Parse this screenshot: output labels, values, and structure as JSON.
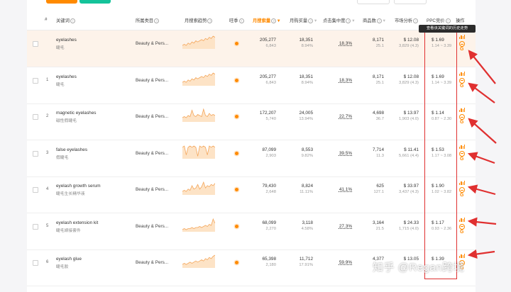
{
  "colors": {
    "accent": "#ff8a00",
    "highlight_row": "#fdf3ea",
    "annotation": "#e03030"
  },
  "header": {
    "idx": "#",
    "keyword": "关键词",
    "category": "所属类目",
    "trend": "月搜索趋势",
    "season": "旺季",
    "search_vol": "月搜索量",
    "purchase_vol": "月购买量",
    "click_conc": "点击集中度",
    "products": "商品数",
    "market": "市场分析",
    "ppc": "PPC竞价",
    "ops": "操作"
  },
  "tooltip": "查看该关键词的历史走势",
  "rows": [
    {
      "idx": "",
      "keyword": "eyelashes",
      "keyword_cn": "睫毛",
      "category": "Beauty & Pers...",
      "search": "205,277",
      "search_sub": "6,843",
      "purchase": "18,351",
      "purchase_pct": "8.94%",
      "click": "18.3%",
      "products": "8,171",
      "products_sub": "25.1",
      "market_price": "$ 12.08",
      "market_sub": "3,829 (4.3)",
      "ppc": "$ 1.69",
      "ppc_range": "1.14 ~ 3.39",
      "trend": [
        3,
        4,
        3,
        5,
        4,
        6,
        5,
        7,
        6,
        7,
        8,
        7,
        9,
        8,
        10,
        9,
        11,
        10
      ]
    },
    {
      "idx": "1",
      "keyword": "eyelashes",
      "keyword_cn": "睫毛",
      "category": "Beauty & Pers...",
      "search": "205,277",
      "search_sub": "6,843",
      "purchase": "18,351",
      "purchase_pct": "8.94%",
      "click": "18.3%",
      "products": "8,171",
      "products_sub": "25.1",
      "market_price": "$ 12.08",
      "market_sub": "3,829 (4.3)",
      "ppc": "$ 1.69",
      "ppc_range": "1.14 ~ 3.39",
      "trend": [
        3,
        4,
        3,
        5,
        4,
        6,
        5,
        7,
        6,
        7,
        8,
        7,
        9,
        8,
        10,
        9,
        11,
        10
      ]
    },
    {
      "idx": "2",
      "keyword": "magnetic eyelashes",
      "keyword_cn": "磁性假睫毛",
      "category": "Beauty & Pers...",
      "search": "172,207",
      "search_sub": "5,740",
      "purchase": "24,005",
      "purchase_pct": "13.94%",
      "click": "22.7%",
      "products": "4,698",
      "products_sub": "36.7",
      "market_price": "$ 13.97",
      "market_sub": "1,903 (4.0)",
      "ppc": "$ 1.14",
      "ppc_range": "0.87 ~ 2.30",
      "trend": [
        4,
        5,
        4,
        6,
        5,
        11,
        6,
        5,
        7,
        6,
        5,
        12,
        6,
        5,
        8,
        6,
        7,
        6
      ]
    },
    {
      "idx": "3",
      "keyword": "false eyelashes",
      "keyword_cn": "假睫毛",
      "category": "Beauty & Pers...",
      "search": "87,099",
      "search_sub": "2,903",
      "purchase": "8,553",
      "purchase_pct": "9.82%",
      "click": "39.5%",
      "products": "7,714",
      "products_sub": "11.3",
      "market_price": "$ 11.41",
      "market_sub": "5,661 (4.4)",
      "ppc": "$ 1.53",
      "ppc_range": "1.17 ~ 3.08",
      "trend": [
        9,
        10,
        3,
        9,
        10,
        9,
        10,
        9,
        2,
        10,
        9,
        10,
        9,
        3,
        10,
        9,
        10,
        9
      ]
    },
    {
      "idx": "4",
      "keyword": "eyelash growth serum",
      "keyword_cn": "睫毛生长精华液",
      "category": "Beauty & Pers...",
      "search": "79,430",
      "search_sub": "2,648",
      "purchase": "8,824",
      "purchase_pct": "11.11%",
      "click": "41.1%",
      "products": "625",
      "products_sub": "127.1",
      "market_price": "$ 33.97",
      "market_sub": "3,437 (4.3)",
      "ppc": "$ 1.90",
      "ppc_range": "1.02 ~ 3.82",
      "trend": [
        3,
        4,
        3,
        5,
        4,
        8,
        5,
        6,
        9,
        5,
        7,
        11,
        6,
        8,
        7,
        9,
        8,
        10
      ]
    },
    {
      "idx": "5",
      "keyword": "eyelash extension kit",
      "keyword_cn": "睫毛嫁接套件",
      "category": "Beauty & Pers...",
      "search": "68,099",
      "search_sub": "2,270",
      "purchase": "3,118",
      "purchase_pct": "4.58%",
      "click": "27.3%",
      "products": "3,164",
      "products_sub": "21.5",
      "market_price": "$ 24.33",
      "market_sub": "1,715 (4.0)",
      "ppc": "$ 1.17",
      "ppc_range": "0.93 ~ 2.36",
      "trend": [
        2,
        3,
        2,
        3,
        3,
        4,
        3,
        4,
        4,
        5,
        4,
        5,
        6,
        5,
        7,
        6,
        12,
        8
      ]
    },
    {
      "idx": "6",
      "keyword": "eyelash glue",
      "keyword_cn": "睫毛胶",
      "category": "Beauty & Pers...",
      "search": "65,398",
      "search_sub": "2,180",
      "purchase": "11,712",
      "purchase_pct": "17.91%",
      "click": "59.9%",
      "products": "4,377",
      "products_sub": "",
      "market_price": "$ 13.05",
      "market_sub": "",
      "ppc": "$ 1.39",
      "ppc_range": "",
      "trend": [
        3,
        4,
        3,
        4,
        5,
        4,
        5,
        6,
        5,
        6,
        7,
        6,
        8,
        7,
        9,
        8,
        10,
        11
      ]
    }
  ],
  "watermark": "知乎 @Regan跨境"
}
